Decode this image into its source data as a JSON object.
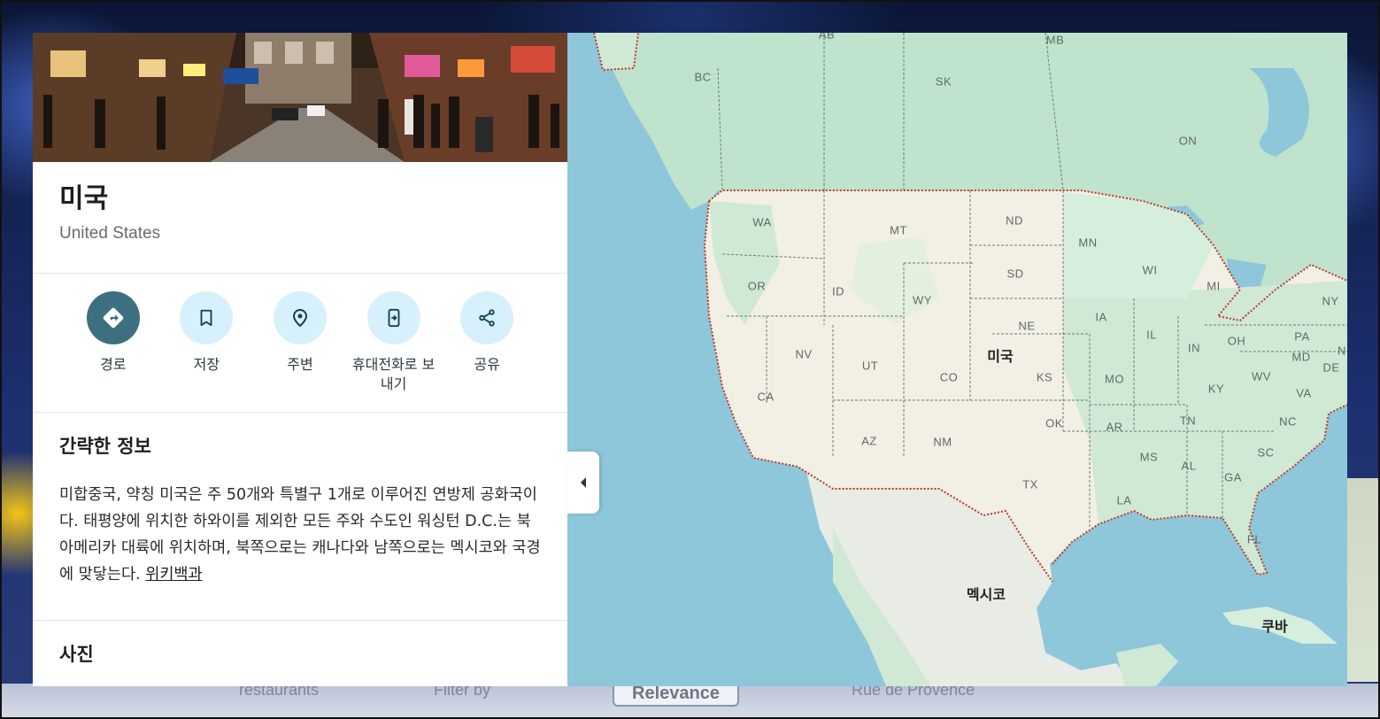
{
  "place": {
    "name": "미국",
    "subtitle": "United States"
  },
  "actions": [
    {
      "label": "경로",
      "icon": "directions-icon"
    },
    {
      "label": "저장",
      "icon": "bookmark-icon"
    },
    {
      "label": "주변",
      "icon": "nearby-icon"
    },
    {
      "label": "휴대전화로 보내기",
      "icon": "send-to-phone-icon"
    },
    {
      "label": "공유",
      "icon": "share-icon"
    }
  ],
  "about": {
    "title": "간략한 정보",
    "text": "미합중국, 약칭 미국은 주 50개와 특별구 1개로 이루어진 연방제 공화국이다. 태평양에 위치한 하와이를 제외한 모든 주와 수도인 워싱턴 D.C.는 북아메리카 대륙에 위치하며, 북쪽으로는 캐나다와 남쪽으로는 멕시코와 국경에 맞닿는다.",
    "link": "위키백과"
  },
  "photos": {
    "title": "사진"
  },
  "map": {
    "country_labels": [
      "미국",
      "멕시코",
      "쿠바"
    ],
    "state_labels": [
      "AB",
      "MB",
      "BC",
      "SK",
      "ON",
      "WA",
      "MT",
      "ND",
      "MN",
      "OR",
      "ID",
      "WY",
      "SD",
      "WI",
      "MI",
      "NY",
      "NE",
      "IA",
      "IL",
      "IN",
      "OH",
      "PA",
      "NV",
      "UT",
      "CO",
      "KS",
      "MO",
      "KY",
      "WV",
      "MD",
      "DE",
      "VA",
      "CA",
      "OK",
      "AR",
      "TN",
      "NC",
      "AZ",
      "NM",
      "MS",
      "AL",
      "SC",
      "GA",
      "TX",
      "LA",
      "FL",
      "N"
    ],
    "colors": {
      "water": "#8ec6da",
      "land_green": "#bfe3cc",
      "land_us": "#f2efe4",
      "border": "#c0392b"
    }
  },
  "background": {
    "chip_label": "Relevance",
    "text_left": "restaurants",
    "text_filter": "Filter by",
    "text_street": "Rue de Provence"
  }
}
